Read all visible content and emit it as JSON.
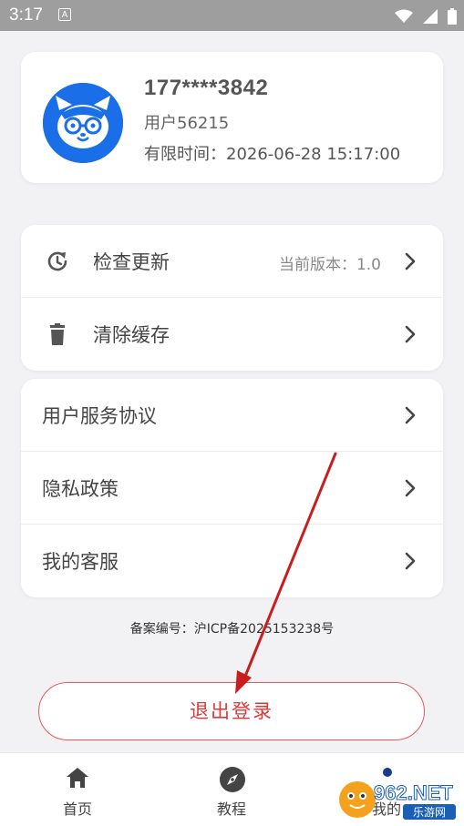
{
  "status_bar": {
    "time": "3:17",
    "notification_letter": "A"
  },
  "profile": {
    "phone": "177****3842",
    "user_name": "用户56215",
    "expire_label": "有限时间：",
    "expire_value": "2026-06-28 15:17:00"
  },
  "settings": [
    {
      "icon": "refresh-clock-icon",
      "label": "检查更新",
      "value": "当前版本：1.0"
    },
    {
      "icon": "trash-icon",
      "label": "清除缓存",
      "value": ""
    }
  ],
  "links": [
    {
      "label": "用户服务协议"
    },
    {
      "label": "隐私政策"
    },
    {
      "label": "我的客服"
    }
  ],
  "icp": "备案编号：沪ICP备2025153238号",
  "logout_label": "退出登录",
  "tabs": [
    {
      "icon": "home-icon",
      "label": "首页"
    },
    {
      "icon": "compass-icon",
      "label": "教程"
    },
    {
      "icon": "profile-icon",
      "label": "我的"
    }
  ],
  "watermark": {
    "main": "962.NET",
    "sub": "乐游网"
  },
  "colors": {
    "accent_red": "#d83a3a",
    "avatar_blue": "#1a6ee8",
    "nav_dot": "#1a3a8c"
  }
}
